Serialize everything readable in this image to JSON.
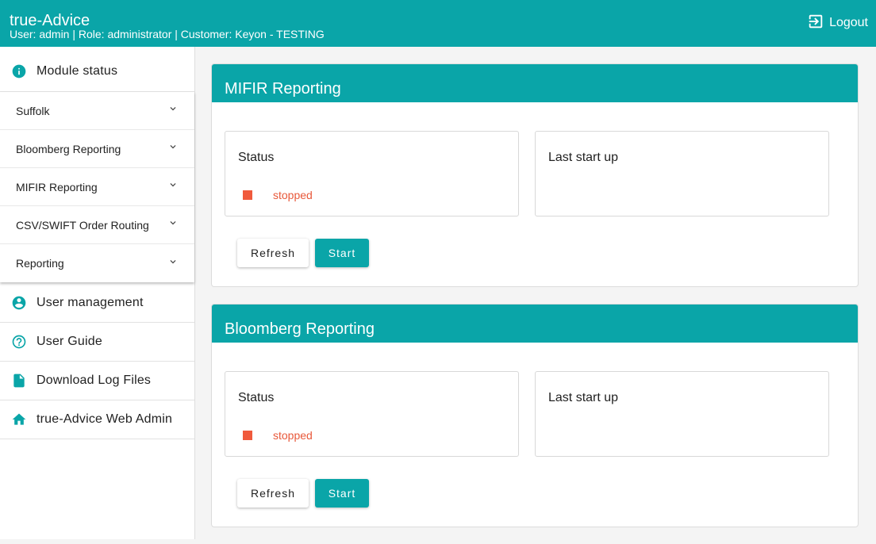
{
  "header": {
    "app_title": "true-Advice",
    "user_info": "User: admin | Role: administrator | Customer: Keyon - TESTING",
    "logout_label": "Logout"
  },
  "sidebar": {
    "module_status": "Module status",
    "modules": [
      {
        "label": "Suffolk"
      },
      {
        "label": "Bloomberg Reporting"
      },
      {
        "label": "MIFIR Reporting"
      },
      {
        "label": "CSV/SWIFT Order Routing"
      },
      {
        "label": "Reporting"
      }
    ],
    "user_management": "User management",
    "user_guide": "User Guide",
    "download_logs": "Download Log Files",
    "web_admin": "true-Advice Web Admin"
  },
  "cards": [
    {
      "title": "MIFIR Reporting",
      "status_title": "Status",
      "status_value": "stopped",
      "startup_title": "Last start up",
      "refresh_label": "Refresh",
      "start_label": "Start"
    },
    {
      "title": "Bloomberg Reporting",
      "status_title": "Status",
      "status_value": "stopped",
      "startup_title": "Last start up",
      "refresh_label": "Refresh",
      "start_label": "Start"
    }
  ],
  "colors": {
    "accent": "#0aa5a8",
    "stopped": "#f05a3c"
  }
}
